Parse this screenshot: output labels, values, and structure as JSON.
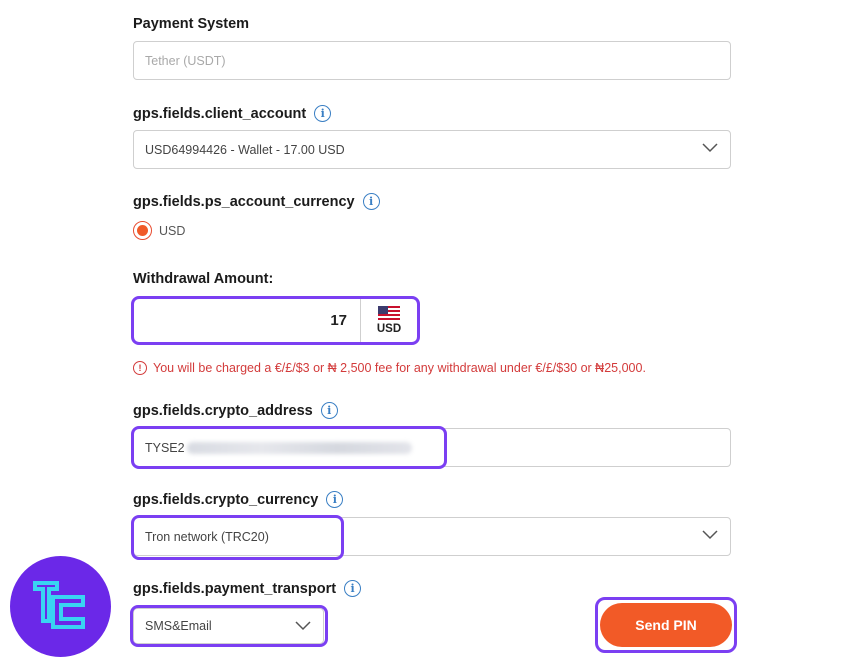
{
  "payment_system": {
    "label": "Payment System",
    "value": "Tether (USDT)"
  },
  "client_account": {
    "label": "gps.fields.client_account",
    "value": "USD64994426 - Wallet - 17.00 USD"
  },
  "ps_account_currency": {
    "label": "gps.fields.ps_account_currency",
    "option": "USD"
  },
  "withdrawal_amount": {
    "label": "Withdrawal Amount:",
    "value": "17",
    "currency": "USD"
  },
  "fee_warning": "You will be charged a €/£/$3 or ₦ 2,500 fee for any withdrawal under €/£/$30 or ₦25,000.",
  "crypto_address": {
    "label": "gps.fields.crypto_address",
    "visible_prefix": "TYSE2"
  },
  "crypto_currency": {
    "label": "gps.fields.crypto_currency",
    "value": "Tron network (TRC20)"
  },
  "payment_transport": {
    "label": "gps.fields.payment_transport",
    "value": "SMS&Email"
  },
  "send_pin_label": "Send PIN",
  "colors": {
    "accent": "#f25a27",
    "highlight": "#7b3ff2",
    "warning": "#d33b3b",
    "info": "#3a7fc4"
  }
}
